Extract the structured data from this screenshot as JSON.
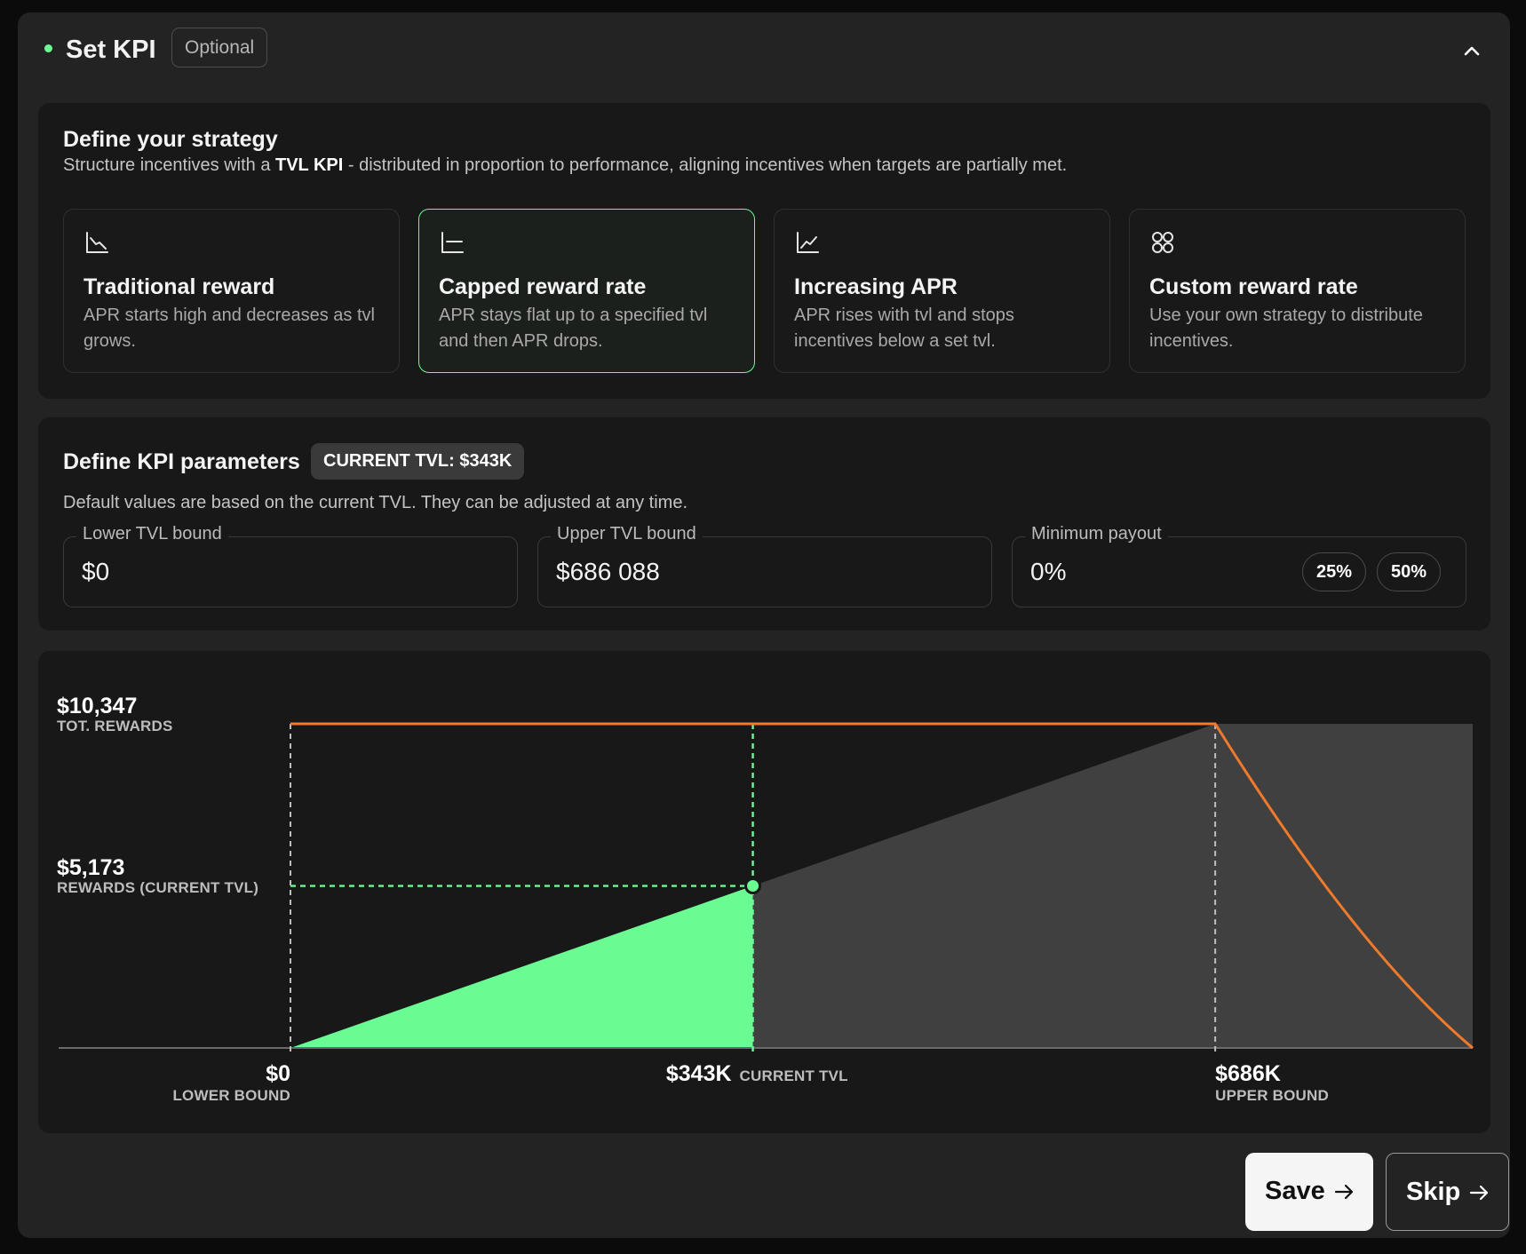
{
  "header": {
    "title": "Set KPI",
    "optional_badge": "Optional",
    "status_color": "#6afb92"
  },
  "strategy": {
    "title": "Define your strategy",
    "subtitle_prefix": "Structure incentives with a ",
    "subtitle_bold": "TVL KPI",
    "subtitle_suffix": " - distributed in proportion to performance, aligning incentives when targets are partially met.",
    "options": [
      {
        "icon": "trending-down-chart-icon",
        "title": "Traditional reward",
        "desc": "APR starts high and decreases as tvl grows.",
        "selected": false
      },
      {
        "icon": "capped-chart-icon",
        "title": "Capped reward rate",
        "desc": "APR stays flat up to a specified tvl and then APR drops.",
        "selected": true
      },
      {
        "icon": "trending-up-chart-icon",
        "title": "Increasing APR",
        "desc": "APR rises with tvl and stops incentives below a set tvl.",
        "selected": false
      },
      {
        "icon": "grid-icon",
        "title": "Custom reward rate",
        "desc": "Use your own strategy to distribute incentives.",
        "selected": false
      }
    ]
  },
  "params": {
    "title": "Define KPI parameters",
    "current_tvl_badge": "CURRENT TVL: $343K",
    "subtitle": "Default values are based on the current TVL. They can be adjusted at any time.",
    "lower": {
      "label": "Lower TVL bound",
      "value": "$0"
    },
    "upper": {
      "label": "Upper TVL bound",
      "value": "$686 088"
    },
    "min_payout": {
      "label": "Minimum payout",
      "value": "0%",
      "presets": [
        "25%",
        "50%"
      ]
    }
  },
  "chart_data": {
    "type": "area",
    "x_unit": "TVL ($)",
    "y_unit": "Rewards ($)",
    "lower_bound": 0,
    "current_tvl": 343000,
    "upper_bound": 686000,
    "x_max": 877000,
    "total_rewards": 10347,
    "current_rewards": 5173,
    "reward_curve": [
      [
        0,
        0
      ],
      [
        343000,
        5173
      ],
      [
        686000,
        10347
      ],
      [
        877000,
        10347
      ]
    ],
    "apr_curve": [
      [
        0,
        10347
      ],
      [
        686000,
        10347
      ],
      [
        877000,
        0
      ]
    ],
    "y_labels": [
      {
        "value": "$10,347",
        "caption": "TOT. REWARDS"
      },
      {
        "value": "$5,173",
        "caption": "REWARDS (CURRENT TVL)"
      }
    ],
    "x_labels": [
      {
        "value": "$0",
        "caption": "LOWER BOUND"
      },
      {
        "value": "$343K",
        "caption": "CURRENT TVL"
      },
      {
        "value": "$686K",
        "caption": "UPPER BOUND"
      }
    ],
    "colors": {
      "earned": "#6afb92",
      "potential": "#404040",
      "apr_line": "#f07a2c",
      "guide": "#bdbdbd"
    }
  },
  "actions": {
    "save": "Save",
    "skip": "Skip"
  }
}
